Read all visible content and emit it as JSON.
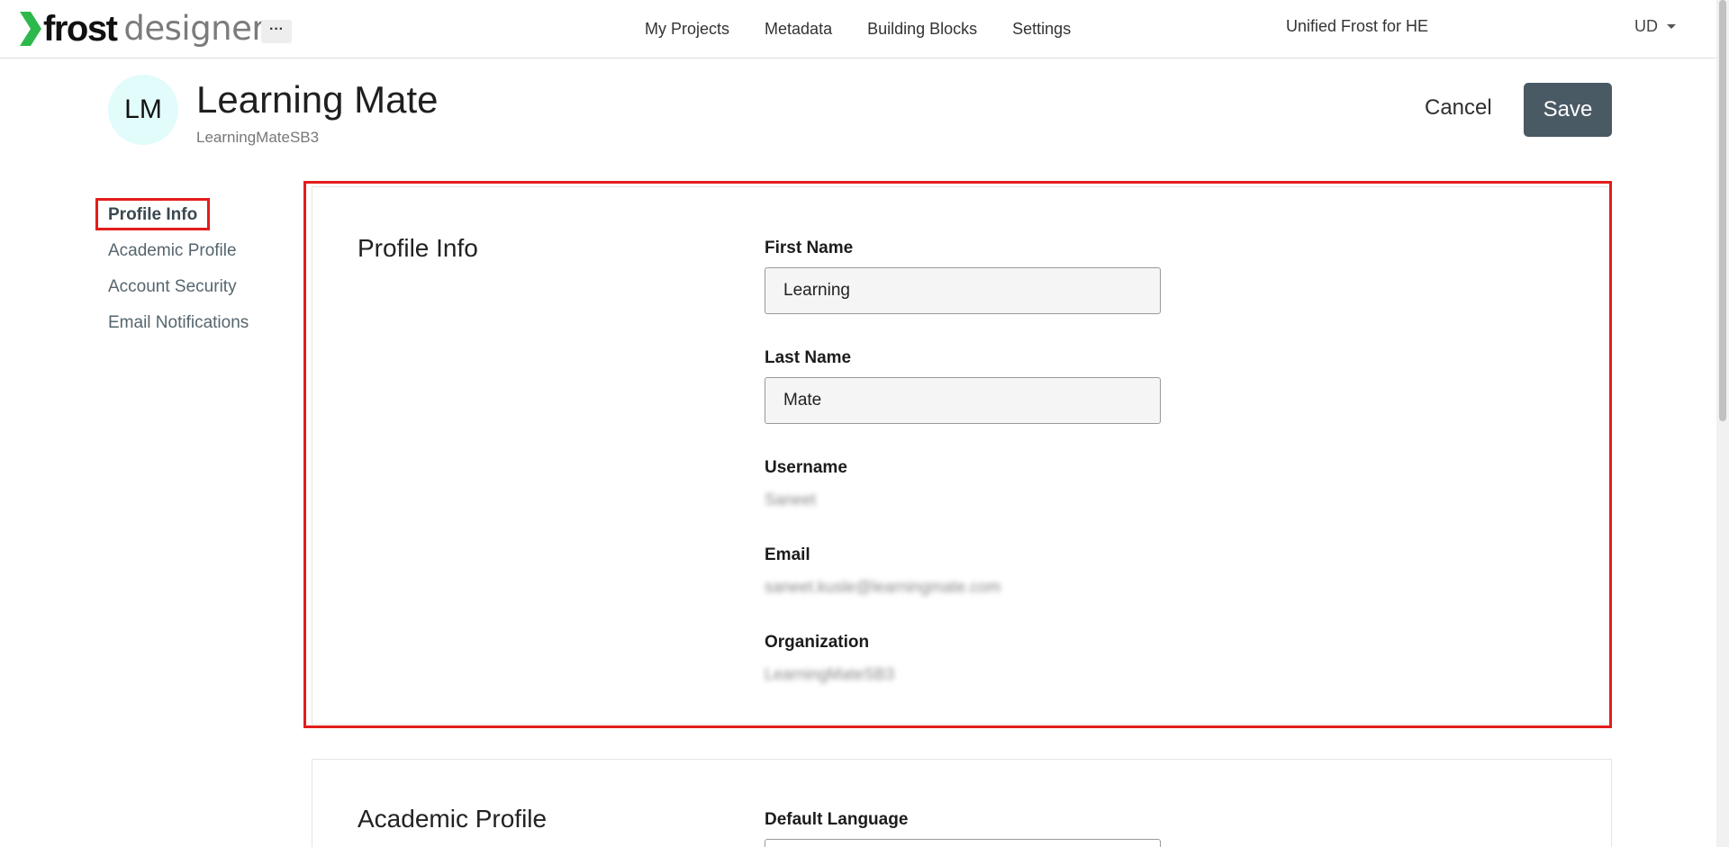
{
  "topbar": {
    "logo_frost": "frost",
    "logo_designer": "designer",
    "more_label": "···",
    "nav": [
      {
        "label": "My Projects"
      },
      {
        "label": "Metadata"
      },
      {
        "label": "Building Blocks"
      },
      {
        "label": "Settings"
      }
    ],
    "org_name": "Unified Frost for HE",
    "user_initials": "UD"
  },
  "header": {
    "avatar_initials": "LM",
    "name": "Learning Mate",
    "subtitle": "LearningMateSB3",
    "cancel_label": "Cancel",
    "save_label": "Save"
  },
  "side_nav": {
    "items": [
      {
        "label": "Profile Info",
        "active": true
      },
      {
        "label": "Academic Profile"
      },
      {
        "label": "Account Security"
      },
      {
        "label": "Email Notifications"
      }
    ]
  },
  "profile_info": {
    "title": "Profile Info",
    "first_name_label": "First Name",
    "first_name_value": "Learning",
    "last_name_label": "Last Name",
    "last_name_value": "Mate",
    "username_label": "Username",
    "username_value": "Saneet",
    "email_label": "Email",
    "email_value": "saneet.kusle@learningmate.com",
    "organization_label": "Organization",
    "organization_value": "LearningMateSB3"
  },
  "academic_profile": {
    "title": "Academic Profile",
    "default_language_label": "Default Language"
  },
  "colors": {
    "accent_red": "#e41c1c",
    "save_button": "#4a5a65",
    "avatar_bg": "#e2fbfb",
    "logo_green": "#2db84b"
  }
}
